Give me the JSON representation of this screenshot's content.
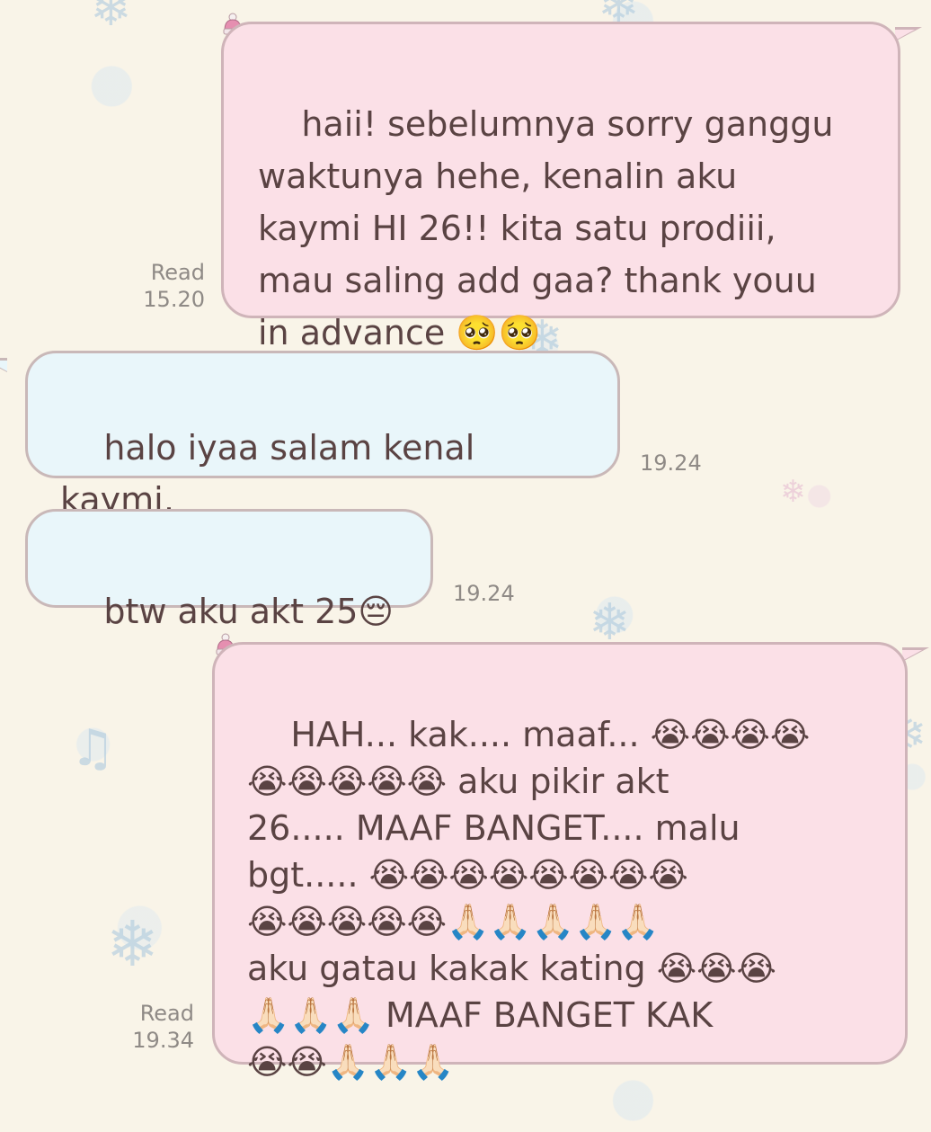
{
  "messages": [
    {
      "side": "out",
      "text": "haii! sebelumnya sorry ganggu\nwaktunya hehe, kenalin aku\nkaymi HI 26!! kita satu prodiii,\nmau saling add gaa? thank youu\nin advance 🥺🥺",
      "status": "Read",
      "time": "15.20"
    },
    {
      "side": "in",
      "text": "halo iyaa salam kenal kaymi,\nboleh kok",
      "time": "19.24"
    },
    {
      "side": "in",
      "text": "btw aku akt 25😔",
      "time": "19.24"
    },
    {
      "side": "out",
      "text": "HAH... kak.... maaf... 😭😭😭😭\n😭😭😭😭😭 aku pikir akt\n26..... MAAF BANGET.... malu\nbgt..... 😭😭😭😭😭😭😭😭\n😭😭😭😭😭🙏🏻🙏🏻🙏🏻🙏🏻🙏🏻\naku gatau kakak kating 😭😭😭\n🙏🏻🙏🏻🙏🏻 MAAF BANGET KAK\n😭😭🙏🏻🙏🏻🙏🏻",
      "status": "Read",
      "time": "19.34"
    }
  ],
  "icons": {
    "sender_avatar": "knit-hat-icon",
    "background": "snowflake-pattern"
  }
}
